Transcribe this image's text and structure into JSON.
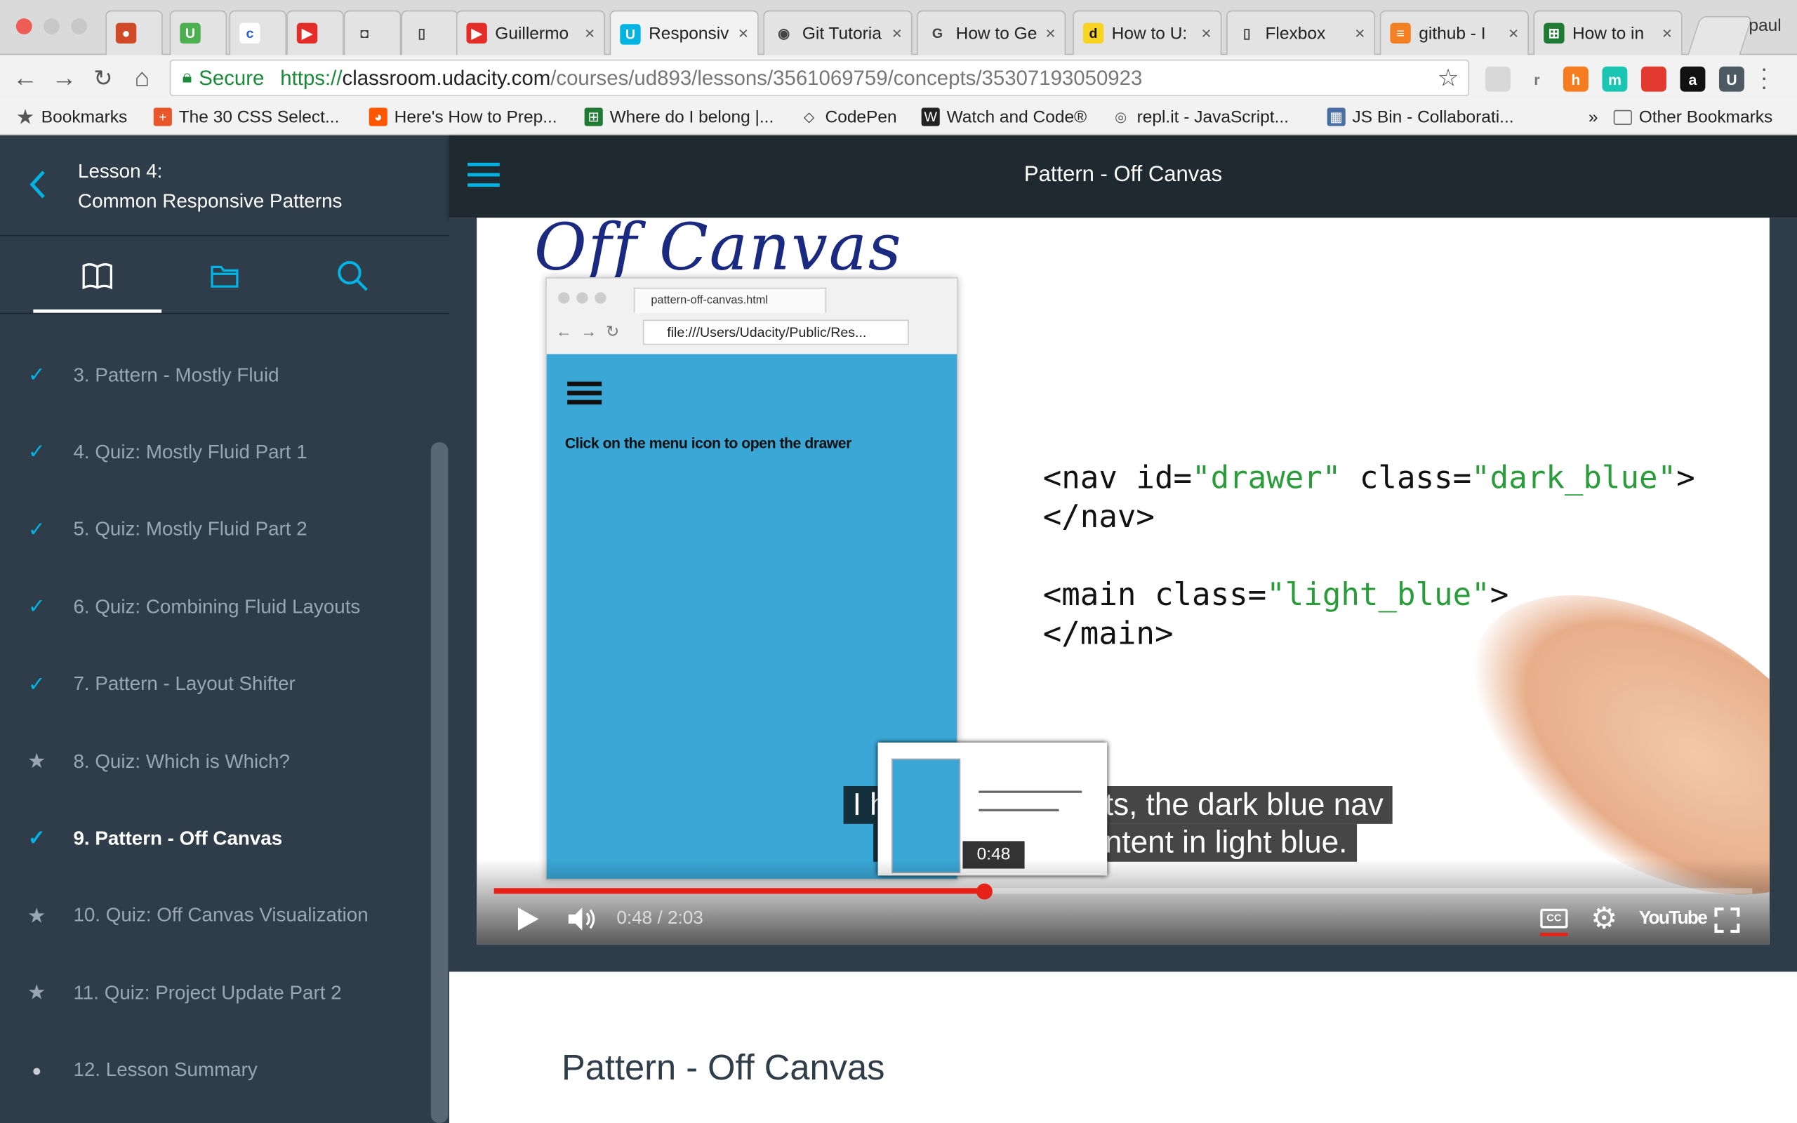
{
  "browser": {
    "tabs": [
      {
        "label": "",
        "icon": "mario-icon"
      },
      {
        "label": "",
        "icon": "u-icon"
      },
      {
        "label": "",
        "icon": "c-icon"
      },
      {
        "label": "",
        "icon": "youtube-icon"
      },
      {
        "label": "",
        "icon": "camera-icon"
      },
      {
        "label": "",
        "icon": "page-icon"
      },
      {
        "label": "Guillermo",
        "icon": "youtube-icon"
      },
      {
        "label": "Responsiv",
        "icon": "udacity-icon",
        "active": true
      },
      {
        "label": "Git Tutoria",
        "icon": "github-icon"
      },
      {
        "label": "How to Ge",
        "icon": "google-icon"
      },
      {
        "label": "How to U:",
        "icon": "d-icon"
      },
      {
        "label": "Flexbox",
        "icon": "page-icon"
      },
      {
        "label": "github - I",
        "icon": "stackoverflow-icon"
      },
      {
        "label": "How to in",
        "icon": "repl-icon"
      }
    ],
    "profile": "paul",
    "secure_label": "Secure",
    "url_scheme": "https://",
    "url_host": "classroom.udacity.com",
    "url_path": "/courses/ud893/lessons/3561069759/concepts/35307193050923",
    "extensions": [
      {
        "label": "",
        "color": "#d8d8d8"
      },
      {
        "label": "r",
        "color": "#f2f2f2"
      },
      {
        "label": "h",
        "color": "#f57c1f"
      },
      {
        "label": "m",
        "color": "#1bc5b3"
      },
      {
        "label": "",
        "color": "#e23a2e"
      },
      {
        "label": "a",
        "color": "#111111"
      },
      {
        "label": "U",
        "color": "#4d5a63"
      }
    ],
    "bookmarks": [
      {
        "label": "Bookmarks",
        "icon": "star-icon"
      },
      {
        "label": "The 30 CSS Select...",
        "icon": "plus-icon"
      },
      {
        "label": "Here's How to Prep...",
        "icon": "reddit-icon"
      },
      {
        "label": "Where do I belong |...",
        "icon": "repl-icon"
      },
      {
        "label": "CodePen",
        "icon": "codepen-icon"
      },
      {
        "label": "Watch and Code®",
        "icon": "w-icon"
      },
      {
        "label": "repl.it - JavaScript...",
        "icon": "replit-icon"
      },
      {
        "label": "JS Bin - Collaborati...",
        "icon": "jsbin-icon"
      }
    ],
    "more_label": "»",
    "other_bookmarks": "Other Bookmarks"
  },
  "sidebar": {
    "lesson_line1": "Lesson 4:",
    "lesson_line2": "Common Responsive Patterns",
    "items": [
      {
        "label": "3. Pattern - Mostly Fluid",
        "mark": "check"
      },
      {
        "label": "4. Quiz: Mostly Fluid Part 1",
        "mark": "check"
      },
      {
        "label": "5. Quiz: Mostly Fluid Part 2",
        "mark": "check"
      },
      {
        "label": "6. Quiz: Combining Fluid Layouts",
        "mark": "check"
      },
      {
        "label": "7. Pattern - Layout Shifter",
        "mark": "check"
      },
      {
        "label": "8. Quiz: Which is Which?",
        "mark": "star"
      },
      {
        "label": "9. Pattern - Off Canvas",
        "mark": "check",
        "active": true
      },
      {
        "label": "10. Quiz: Off Canvas Visualization",
        "mark": "star"
      },
      {
        "label": "11. Quiz: Project Update Part 2",
        "mark": "star"
      },
      {
        "label": "12. Lesson Summary",
        "mark": "dot"
      }
    ]
  },
  "header": {
    "title": "Pattern - Off Canvas"
  },
  "video": {
    "handwritten_title": "Off Canvas",
    "mock": {
      "tab_title": "pattern-off-canvas.html",
      "url": "file:///Users/Udacity/Public/Res...",
      "body_text": "Click on the menu icon to open the drawer"
    },
    "code": {
      "l1a": "<nav id=",
      "l1b": "\"drawer\"",
      "l1c": " class=",
      "l1d": "\"dark_blue\"",
      "l1e": ">",
      "l2": "</nav>",
      "l3a": "<main class=",
      "l3b": "\"light_blue\"",
      "l3c": ">",
      "l4": "</main>"
    },
    "caption_line1_left": "I h",
    "caption_line1_right": "ts, the dark blue nav",
    "caption_line2_right": "ntent in light blue.",
    "preview_time": "0:48",
    "time": "0:48 / 2:03",
    "progress": 0.39,
    "youtube_label": "YouTube"
  },
  "content": {
    "heading": "Pattern - Off Canvas"
  },
  "colors": {
    "accent": "#02b3e4",
    "progress": "#e62117",
    "sidebar": "#2e3d49",
    "topbar": "#1f2930"
  }
}
